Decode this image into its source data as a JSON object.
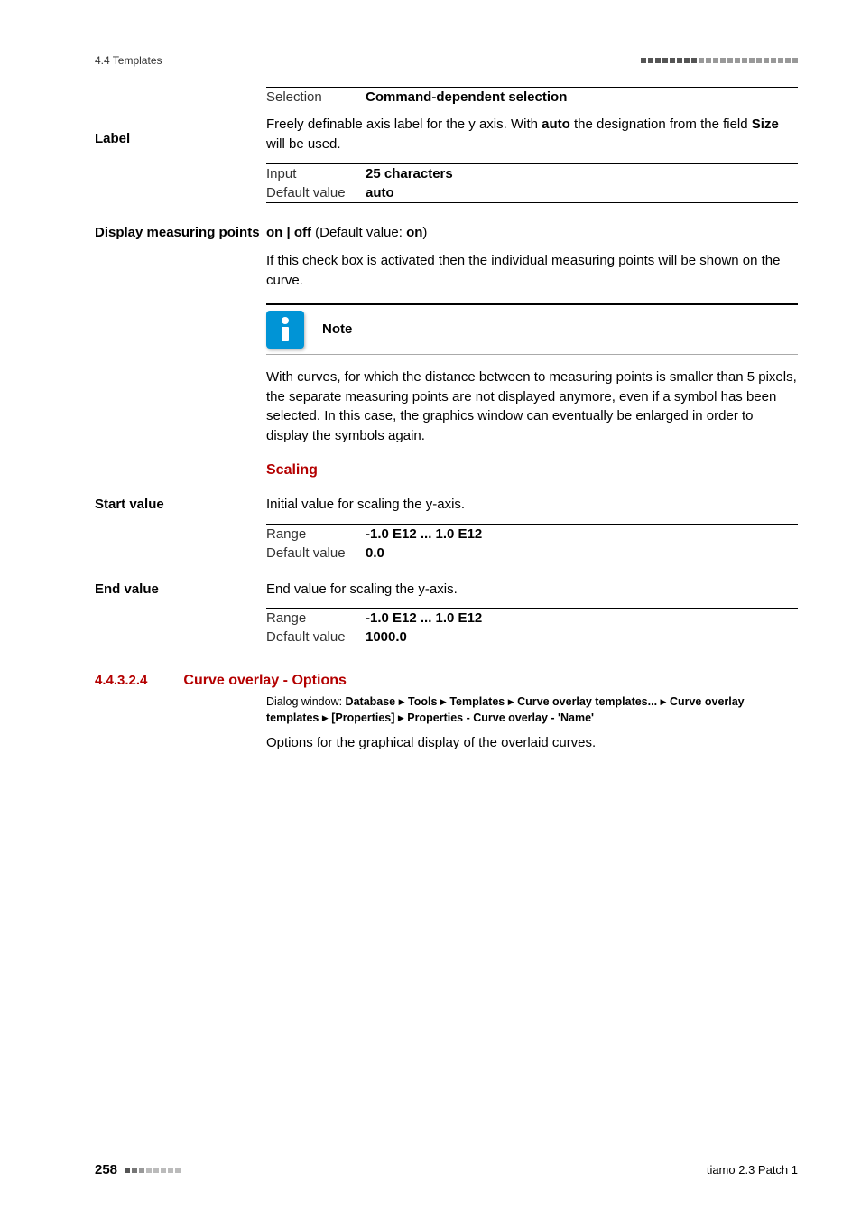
{
  "header": {
    "section_ref": "4.4 Templates"
  },
  "selection_row": {
    "label": "Selection",
    "value": "Command-dependent selection"
  },
  "label_block": {
    "side": "Label",
    "desc_pre": "Freely definable axis label for the y axis. With ",
    "desc_b1": "auto",
    "desc_mid": " the designation from the field ",
    "desc_b2": "Size",
    "desc_post": " will be used.",
    "rows": [
      {
        "k": "Input",
        "v": "25 characters"
      },
      {
        "k": "Default value",
        "v": "auto"
      }
    ]
  },
  "display_points": {
    "side": "Display measuring points",
    "toggle_pre": "on | off",
    "toggle_mid": " (Default value: ",
    "toggle_b": "on",
    "toggle_post": ")",
    "desc": "If this check box is activated then the individual measuring points will be shown on the curve.",
    "note_label": "Note",
    "note_body": "With curves, for which the distance between to measuring points is smaller than 5 pixels, the separate measuring points are not displayed anymore, even if a symbol has been selected. In this case, the graphics window can eventually be enlarged in order to display the symbols again."
  },
  "scaling": {
    "heading": "Scaling",
    "start": {
      "side": "Start value",
      "desc": "Initial value for scaling the y-axis.",
      "rows": [
        {
          "k": "Range",
          "v": "-1.0 E12 ... 1.0 E12"
        },
        {
          "k": "Default value",
          "v": "0.0"
        }
      ]
    },
    "end": {
      "side": "End value",
      "desc": "End value for scaling the y-axis.",
      "rows": [
        {
          "k": "Range",
          "v": "-1.0 E12 ... 1.0 E12"
        },
        {
          "k": "Default value",
          "v": "1000.0"
        }
      ]
    }
  },
  "curve_overlay": {
    "num": "4.4.3.2.4",
    "title": "Curve overlay - Options",
    "path_prefix": "Dialog window: ",
    "path_parts": [
      "Database",
      "Tools",
      "Templates",
      "Curve overlay templates...",
      "Curve overlay templates",
      "[Properties]",
      "Properties - Curve overlay - 'Name'"
    ],
    "desc": "Options for the graphical display of the overlaid curves."
  },
  "footer": {
    "page": "258",
    "product": "tiamo 2.3 Patch 1"
  }
}
